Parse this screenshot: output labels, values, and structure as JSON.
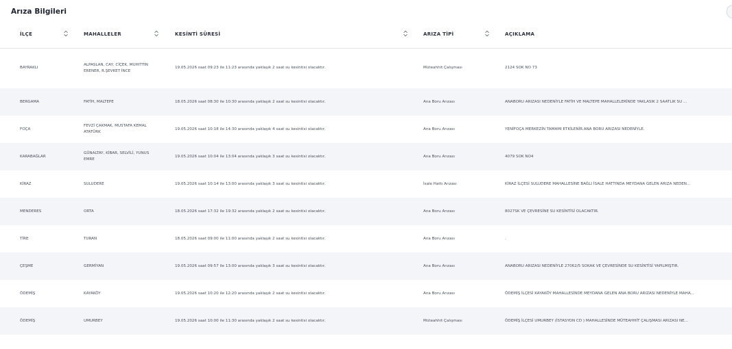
{
  "page": {
    "title": "Arıza Bilgileri"
  },
  "table": {
    "headers": {
      "ilce": "İLÇE",
      "mahalleler": "MAHALLELER",
      "kesinti": "KESİNTİ SÜRESİ",
      "ariza_tipi": "ARIZA TİPİ",
      "aciklama": "AÇIKLAMA"
    },
    "rows": [
      {
        "ilce": "BAYRAKLI",
        "mahalleler": "ALPASLAN, CAY, CİÇEK, MUHITTIN ERENER, R.ŞEVKET İNCE",
        "kesinti": "19.05.2026 saat 09:23 ile 11:23 arasında yaklaşık 2 saat su kesintisi olacaktır.",
        "ariza_tipi": "Müteahhit Çalışması",
        "aciklama": "2124 SOK NO 73"
      },
      {
        "ilce": "BERGAMA",
        "mahalleler": "FATİH, MALTEPE",
        "kesinti": "18.05.2026 saat 08:30 ile 10:30 arasında yaklaşık 2 saat su kesintisi olacaktır.",
        "ariza_tipi": "Ana Boru Arızası",
        "aciklama": "ANABORU ARIZASI NEDENİYLE FATİH VE MALTEPE MAHALLELERİNDE YAKLASIK 2 SAATLIK SU ..."
      },
      {
        "ilce": "FOÇA",
        "mahalleler": "FEVZİ ÇAKMAK, MUSTAFA KEMAL ATATÜRK",
        "kesinti": "19.05.2026 saat 10:18 ile 14:30 arasında yaklaşık 4 saat su kesintisi olacaktır.",
        "ariza_tipi": "Ana Boru Arızası",
        "aciklama": "YENİFOÇA MERKEZİN TAMAMI ETKİLENİR.ANA BORU ARIZASI NEDENİYLE."
      },
      {
        "ilce": "KARABAĞLAR",
        "mahalleler": "GÜNALTAY, KİBAR, SELVİLİ, YUNUS EMRE",
        "kesinti": "19.05.2026 saat 10:04 ile 13:04 arasında yaklaşık 3 saat su kesintisi olacaktır.",
        "ariza_tipi": "Ana Boru Arızası",
        "aciklama": "4079 SOK NO4"
      },
      {
        "ilce": "KİRAZ",
        "mahalleler": "SULUDERE",
        "kesinti": "19.05.2026 saat 10:14 ile 13:00 arasında yaklaşık 3 saat su kesintisi olacaktır.",
        "ariza_tipi": "İsale Hattı Arızası",
        "aciklama": "KİRAZ İLÇESİ SULUDERE MAHALLESİNE BAĞLI İSALE HATTINDA MEYDANA GELEN ARIZA NEDEN..."
      },
      {
        "ilce": "MENDERES",
        "mahalleler": "ORTA",
        "kesinti": "18.05.2026 saat 17:32 ile 19:32 arasında yaklaşık 2 saat su kesintisi olacaktır.",
        "ariza_tipi": "Ana Boru Arızası",
        "aciklama": "8027SK VE ÇEVRESİNE SU KESİNTİSİ OLACAKTIR."
      },
      {
        "ilce": "TİRE",
        "mahalleler": "TURAN",
        "kesinti": "18.05.2026 saat 09:00 ile 11:00 arasında yaklaşık 2 saat su kesintisi olacaktır.",
        "ariza_tipi": "Ana Boru Arızası",
        "aciklama": "."
      },
      {
        "ilce": "ÇEŞME",
        "mahalleler": "GERMİYAN",
        "kesinti": "19.05.2026 saat 09:57 ile 13:00 arasında yaklaşık 3 saat su kesintisi olacaktır.",
        "ariza_tipi": "Ana Boru Arızası",
        "aciklama": "ANABORU ARIZASI NEDENİYLE 27062/5 SOKAK VE ÇEVRESİNDE SU KESİNTİSİ YAPILMIŞTIR."
      },
      {
        "ilce": "ÖDEMİŞ",
        "mahalleler": "KAYAKÖY",
        "kesinti": "19.05.2026 saat 10:20 ile 12:20 arasında yaklaşık 2 saat su kesintisi olacaktır.",
        "ariza_tipi": "Ana Boru Arızası",
        "aciklama": "ÖDEMİŞ İLÇESİ KAYAKÖY MAHALLESİNDE MEYDANA GELEN ANA BORU ARIZASI NEDENİYLE MAHA..."
      },
      {
        "ilce": "ÖDEMİŞ",
        "mahalleler": "UMURBEY",
        "kesinti": "19.05.2026 saat 10:00 ile 11:30 arasında yaklaşık 2 saat su kesintisi olacaktır.",
        "ariza_tipi": "Müteahhit Çalışması",
        "aciklama": "ÖDEMİŞ İLÇESİ UMURBEY (İSTASYON CD ) MAHALLESİNDE MÜTEAHHİT ÇALIŞMASI ARIZASI NE..."
      }
    ]
  }
}
